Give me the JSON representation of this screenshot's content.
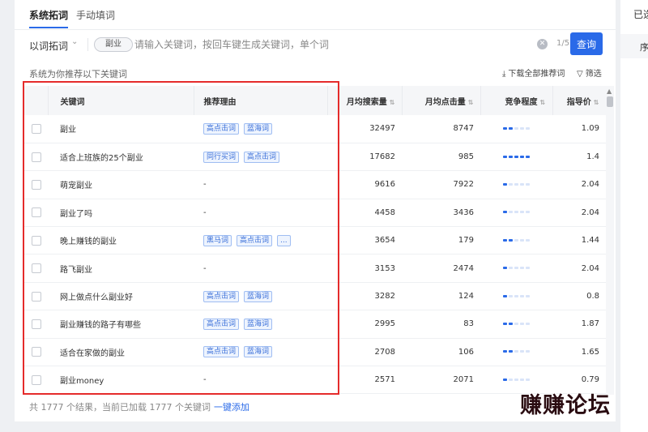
{
  "tabs": [
    {
      "label": "系统拓词",
      "active": true
    },
    {
      "label": "手动填词",
      "active": false
    }
  ],
  "search": {
    "mode": "以词拓词",
    "chip": "副业",
    "placeholder": "请输入关键词，按回车键生成关键词，单个词",
    "count": "1/5",
    "button": "查询"
  },
  "toolbar": {
    "recommend_label": "系统为你推荐以下关键词",
    "download": "下载全部推荐词",
    "filter": "筛选"
  },
  "table": {
    "headers": {
      "keyword": "关键词",
      "reason": "推荐理由",
      "monthly_search": "月均搜索量",
      "monthly_click": "月均点击量",
      "competition": "竞争程度",
      "price": "指导价"
    },
    "rows": [
      {
        "keyword": "副业",
        "reasons": [
          "高点击词",
          "蓝海词"
        ],
        "search": "32497",
        "click": "8747",
        "competition": 2,
        "price": "1.09"
      },
      {
        "keyword": "适合上班族的25个副业",
        "reasons": [
          "同行买词",
          "高点击词"
        ],
        "search": "17682",
        "click": "985",
        "competition": 5,
        "price": "1.4"
      },
      {
        "keyword": "萌宠副业",
        "reasons": [],
        "reason_empty": "-",
        "search": "9616",
        "click": "7922",
        "competition": 1,
        "price": "2.04"
      },
      {
        "keyword": "副业了吗",
        "reasons": [],
        "reason_empty": "-",
        "search": "4458",
        "click": "3436",
        "competition": 1,
        "price": "2.04"
      },
      {
        "keyword": "晚上赚钱的副业",
        "reasons": [
          "黑马词",
          "高点击词",
          "..."
        ],
        "search": "3654",
        "click": "179",
        "competition": 2,
        "price": "1.44"
      },
      {
        "keyword": "路飞副业",
        "reasons": [],
        "reason_empty": "-",
        "search": "3153",
        "click": "2474",
        "competition": 1,
        "price": "2.04"
      },
      {
        "keyword": "网上做点什么副业好",
        "reasons": [
          "高点击词",
          "蓝海词"
        ],
        "search": "3282",
        "click": "124",
        "competition": 1,
        "price": "0.8"
      },
      {
        "keyword": "副业赚钱的路子有哪些",
        "reasons": [
          "高点击词",
          "蓝海词"
        ],
        "search": "2995",
        "click": "83",
        "competition": 2,
        "price": "1.87"
      },
      {
        "keyword": "适合在家做的副业",
        "reasons": [
          "高点击词",
          "蓝海词"
        ],
        "search": "2708",
        "click": "106",
        "competition": 2,
        "price": "1.65"
      },
      {
        "keyword": "副业money",
        "reasons": [],
        "reason_empty": "-",
        "search": "2571",
        "click": "2071",
        "competition": 1,
        "price": "0.79"
      }
    ]
  },
  "footer": {
    "summary": "共 1777 个结果，当前已加载 1777 个关键词",
    "add_all": "一键添加"
  },
  "side_panel": {
    "title": "已选",
    "header": "序"
  },
  "watermark": "赚赚论坛",
  "colors": {
    "primary": "#2a6ae8",
    "highlight": "#e52b2b",
    "tag_bg": "#eef4fe",
    "tag_border": "#9fbdf2"
  }
}
